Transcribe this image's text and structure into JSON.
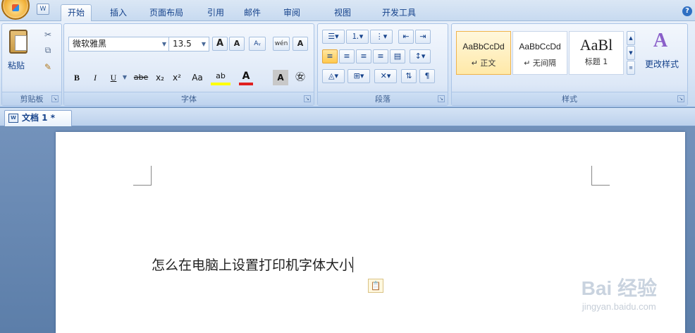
{
  "tabs": [
    "开始",
    "插入",
    "页面布局",
    "引用",
    "邮件",
    "审阅",
    "视图",
    "开发工具"
  ],
  "help_icon": "?",
  "qat_icon": "W",
  "clipboard": {
    "paste_label": "粘贴",
    "group_label": "剪贴板"
  },
  "font": {
    "font_name": "微软雅黑",
    "font_size": "13.5",
    "grow_label": "A",
    "shrink_label": "A",
    "bold": "B",
    "italic": "I",
    "underline": "U",
    "strike": "abe",
    "subscript": "x₂",
    "superscript": "x²",
    "change_case": "Aa",
    "highlight": "ab",
    "font_color": "A",
    "char_shading": "A",
    "enclose": "㊛",
    "phonetic": "wén",
    "border_char": "A",
    "clear_format": "Aᵧ",
    "group_label": "字体"
  },
  "paragraph": {
    "group_label": "段落"
  },
  "styles": {
    "items": [
      {
        "sample": "AaBbCcDd",
        "name": "↵ 正文"
      },
      {
        "sample": "AaBbCcDd",
        "name": "↵ 无间隔"
      },
      {
        "sample": "AaBl",
        "name": "标题 1"
      }
    ],
    "change_label": "更改样式",
    "group_label": "样式"
  },
  "document": {
    "tab_title": "文档 1 *",
    "text": "怎么在电脑上设置打印机字体大小"
  },
  "watermark": {
    "main": "Bai  经验",
    "sub": "jingyan.baidu.com"
  },
  "colors": {
    "accent": "#15428b",
    "highlight": "#ffff00",
    "font_color": "#e02020"
  }
}
